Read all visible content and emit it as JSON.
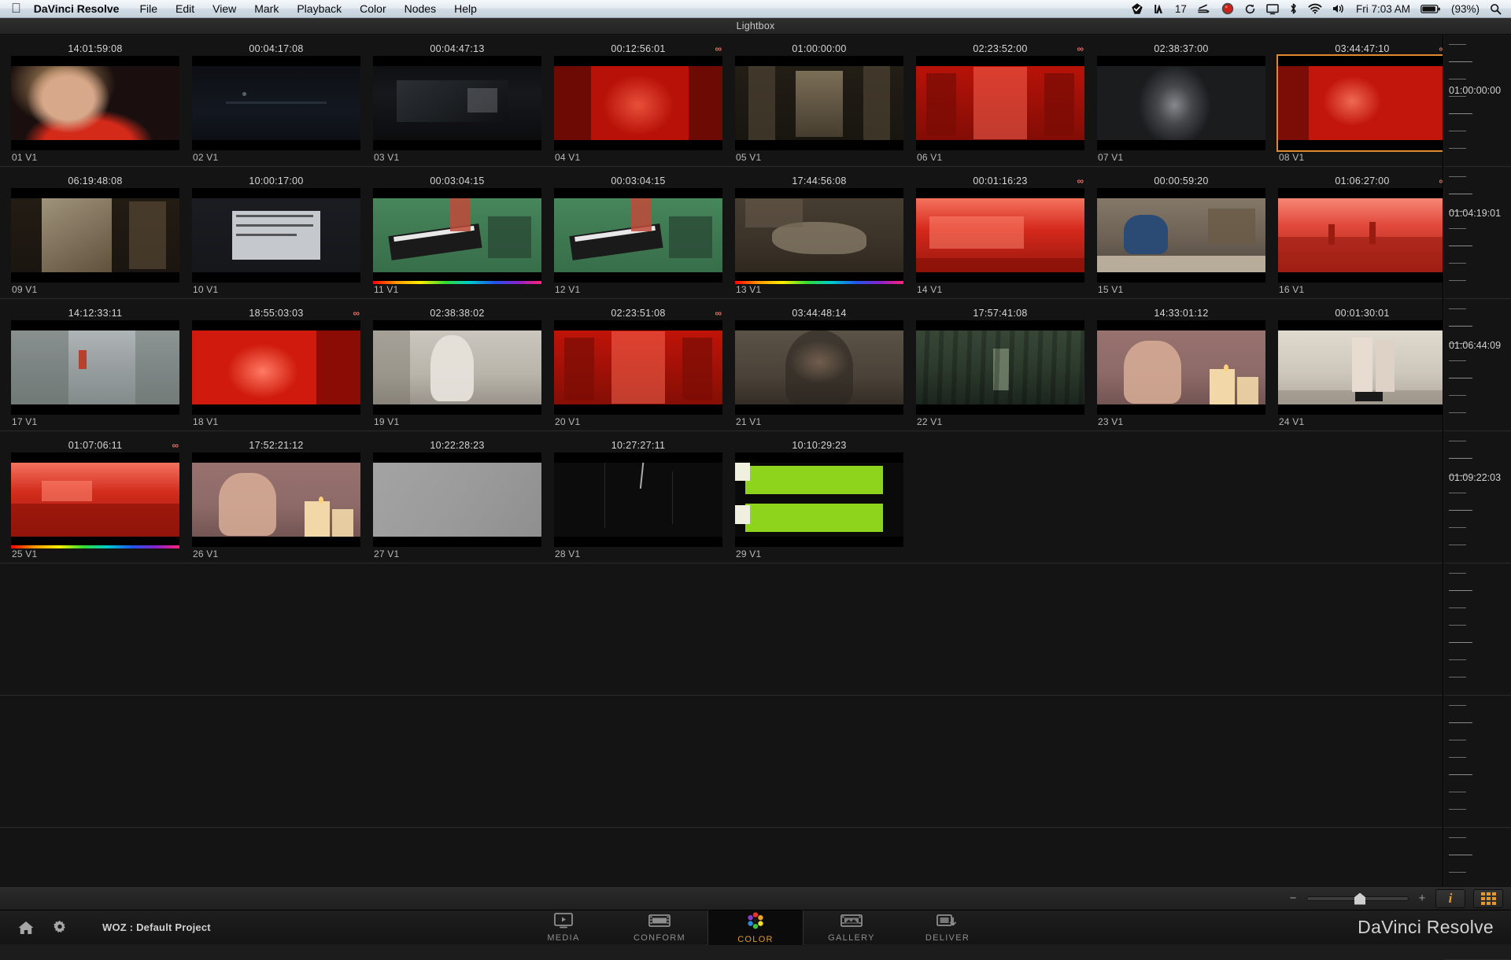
{
  "menubar": {
    "apple_icon": "apple-logo-icon",
    "items": [
      {
        "label": "DaVinci Resolve",
        "bold": true
      },
      {
        "label": "File"
      },
      {
        "label": "Edit"
      },
      {
        "label": "View"
      },
      {
        "label": "Mark"
      },
      {
        "label": "Playback"
      },
      {
        "label": "Color"
      },
      {
        "label": "Nodes"
      },
      {
        "label": "Help"
      }
    ],
    "status": {
      "dropbox_icon": "dropbox-check-icon",
      "alfred_icon": "alfred-hat-icon",
      "alfred_count": "17",
      "scanner_icon": "scanner-icon",
      "record_icon": "record-red-icon",
      "refresh_icon": "refresh-icon",
      "display_icon": "display-icon",
      "bluetooth_icon": "bluetooth-icon",
      "wifi_icon": "wifi-icon",
      "volume_icon": "volume-icon",
      "clock": "Fri 7:03 AM",
      "battery_icon": "battery-icon",
      "battery_pct": "(93%)",
      "spotlight_icon": "search-icon"
    }
  },
  "titlestrip": {
    "title": "Lightbox"
  },
  "lightbox": {
    "rows": [
      {
        "ruler_tc": "01:00:00:00",
        "clips": [
          {
            "tc": "14:01:59:08",
            "name": "01 V1",
            "linked": false,
            "selected": false,
            "rainbow": false,
            "img": {
              "kind": "portrait-red",
              "base": "#1a0f0e",
              "skin": "#d8a88a",
              "accent": "#d42a1a",
              "hair": "#caa06a"
            }
          },
          {
            "tc": "00:04:17:08",
            "name": "02 V1",
            "linked": false,
            "selected": false,
            "rainbow": false,
            "img": {
              "kind": "night-city",
              "base": "#0b0d10",
              "accent": "#3a4450",
              "glow": "#6a7684"
            }
          },
          {
            "tc": "00:04:47:13",
            "name": "03 V1",
            "linked": false,
            "selected": false,
            "rainbow": false,
            "img": {
              "kind": "night-window",
              "base": "#0a0b0d",
              "accent": "#2e3338",
              "glow": "#8e9298"
            }
          },
          {
            "tc": "00:12:56:01",
            "name": "04 V1",
            "linked": true,
            "selected": false,
            "rainbow": false,
            "img": {
              "kind": "red-portrait",
              "base": "#b81208",
              "skin": "#e8503a",
              "accent": "#6e0a04"
            }
          },
          {
            "tc": "01:00:00:00",
            "name": "05 V1",
            "linked": false,
            "selected": false,
            "rainbow": false,
            "img": {
              "kind": "corridor",
              "base": "#17140f",
              "accent": "#554a39",
              "glow": "#9a8a6e"
            }
          },
          {
            "tc": "02:23:52:00",
            "name": "06 V1",
            "linked": true,
            "selected": false,
            "rainbow": false,
            "img": {
              "kind": "red-interior",
              "base": "#c01309",
              "accent": "#7a0c05",
              "glow": "#ff6a55"
            }
          },
          {
            "tc": "02:38:37:00",
            "name": "07 V1",
            "linked": false,
            "selected": false,
            "rainbow": false,
            "img": {
              "kind": "statue-dark",
              "base": "#1b1c1e",
              "accent": "#45474b",
              "glow": "#86888d"
            }
          },
          {
            "tc": "03:44:47:10",
            "name": "08 V1",
            "linked": true,
            "selected": true,
            "rainbow": false,
            "img": {
              "kind": "red-woman",
              "base": "#c2150b",
              "skin": "#ef6a52",
              "accent": "#7c0d06"
            }
          }
        ]
      },
      {
        "ruler_tc": "01:04:19:01",
        "clips": [
          {
            "tc": "06:19:48:08",
            "name": "09 V1",
            "linked": false,
            "selected": false,
            "rainbow": false,
            "img": {
              "kind": "room-door",
              "base": "#19140f",
              "accent": "#6b5a42",
              "glow": "#b7a98e"
            }
          },
          {
            "tc": "10:00:17:00",
            "name": "10 V1",
            "linked": false,
            "selected": false,
            "rainbow": false,
            "img": {
              "kind": "slate-hand",
              "base": "#15161a",
              "accent": "#9aa0a8",
              "glow": "#d8dce0"
            }
          },
          {
            "tc": "00:03:04:15",
            "name": "11 V1",
            "linked": false,
            "selected": false,
            "rainbow": true,
            "img": {
              "kind": "greenscreen-slate",
              "base": "#3f7a52",
              "accent": "#1f3a2a",
              "glow": "#86b894"
            }
          },
          {
            "tc": "00:03:04:15",
            "name": "12 V1",
            "linked": false,
            "selected": false,
            "rainbow": false,
            "img": {
              "kind": "greenscreen-slate",
              "base": "#3f7a52",
              "accent": "#1f3a2a",
              "glow": "#86b894"
            }
          },
          {
            "tc": "17:44:56:08",
            "name": "13 V1",
            "linked": false,
            "selected": false,
            "rainbow": true,
            "img": {
              "kind": "ground-body",
              "base": "#3a3228",
              "accent": "#6b6050",
              "glow": "#a79a84"
            }
          },
          {
            "tc": "00:01:16:23",
            "name": "14 V1",
            "linked": true,
            "selected": false,
            "rainbow": false,
            "img": {
              "kind": "red-street",
              "base": "#d5291c",
              "accent": "#8b1208",
              "glow": "#ff8a72"
            }
          },
          {
            "tc": "00:00:59:20",
            "name": "15 V1",
            "linked": false,
            "selected": false,
            "rainbow": false,
            "img": {
              "kind": "garage-scene",
              "base": "#6e6256",
              "accent": "#2b4a74",
              "glow": "#c9bda9"
            }
          },
          {
            "tc": "01:06:27:00",
            "name": "16 V1",
            "linked": true,
            "selected": false,
            "rainbow": false,
            "img": {
              "kind": "red-desert",
              "base": "#e0483a",
              "accent": "#9a1b10",
              "glow": "#ff9d8a"
            }
          }
        ]
      },
      {
        "ruler_tc": "01:06:44:09",
        "clips": [
          {
            "tc": "14:12:33:11",
            "name": "17 V1",
            "linked": false,
            "selected": false,
            "rainbow": false,
            "img": {
              "kind": "beach-path",
              "base": "#9aa0a2",
              "accent": "#5a6360",
              "glow": "#d2d6d4"
            }
          },
          {
            "tc": "18:55:03:03",
            "name": "18 V1",
            "linked": true,
            "selected": false,
            "rainbow": false,
            "img": {
              "kind": "red-figure",
              "base": "#cf1a0d",
              "accent": "#7e0b04",
              "glow": "#ff7a62"
            }
          },
          {
            "tc": "02:38:38:02",
            "name": "19 V1",
            "linked": false,
            "selected": false,
            "rainbow": false,
            "img": {
              "kind": "statue-bright",
              "base": "#b9b4aa",
              "accent": "#6f6a60",
              "glow": "#e6e2da"
            }
          },
          {
            "tc": "02:23:51:08",
            "name": "20 V1",
            "linked": true,
            "selected": false,
            "rainbow": false,
            "img": {
              "kind": "red-interior",
              "base": "#c81409",
              "accent": "#7c0d05",
              "glow": "#ff6d56"
            }
          },
          {
            "tc": "03:44:48:14",
            "name": "21 V1",
            "linked": false,
            "selected": false,
            "rainbow": false,
            "img": {
              "kind": "hood-portrait",
              "base": "#4a4238",
              "skin": "#c8a588",
              "accent": "#2a251f"
            }
          },
          {
            "tc": "17:57:41:08",
            "name": "22 V1",
            "linked": false,
            "selected": false,
            "rainbow": false,
            "img": {
              "kind": "forest-figure",
              "base": "#2c3a2c",
              "accent": "#17201a",
              "glow": "#7e8e74"
            }
          },
          {
            "tc": "14:33:01:12",
            "name": "23 V1",
            "linked": false,
            "selected": false,
            "rainbow": false,
            "img": {
              "kind": "candle-woman",
              "base": "#8d6a68",
              "skin": "#d8ae96",
              "accent": "#f2d8a8"
            }
          },
          {
            "tc": "00:01:30:01",
            "name": "24 V1",
            "linked": false,
            "selected": false,
            "rainbow": false,
            "img": {
              "kind": "legs-stairs",
              "base": "#cfc8bc",
              "accent": "#8e867a",
              "glow": "#f2eee6"
            }
          }
        ]
      },
      {
        "ruler_tc": "01:09:22:03",
        "clips": [
          {
            "tc": "01:07:06:11",
            "name": "25 V1",
            "linked": true,
            "selected": false,
            "rainbow": true,
            "img": {
              "kind": "red-landscape",
              "base": "#d32c1c",
              "accent": "#8d1309",
              "glow": "#ff8b74"
            }
          },
          {
            "tc": "17:52:21:12",
            "name": "26 V1",
            "linked": false,
            "selected": false,
            "rainbow": false,
            "img": {
              "kind": "candle-woman",
              "base": "#8d6a68",
              "skin": "#d8ae96",
              "accent": "#f2d8a8"
            }
          },
          {
            "tc": "10:22:28:23",
            "name": "27 V1",
            "linked": false,
            "selected": false,
            "rainbow": false,
            "img": {
              "kind": "grey-flat",
              "base": "#9b9b9b",
              "accent": "#8a8a8a",
              "glow": "#b0b0b0"
            }
          },
          {
            "tc": "10:27:27:11",
            "name": "28 V1",
            "linked": false,
            "selected": false,
            "rainbow": false,
            "img": {
              "kind": "black-scratch",
              "base": "#0c0c0c",
              "accent": "#2a2a2a",
              "glow": "#c8c8c8"
            }
          },
          {
            "tc": "10:10:29:23",
            "name": "29 V1",
            "linked": false,
            "selected": false,
            "rainbow": false,
            "img": {
              "kind": "green-bars",
              "base": "#8fd41c",
              "accent": "#0a0a0a",
              "glow": "#f0f0e0"
            }
          }
        ]
      }
    ]
  },
  "zoombar": {
    "minus": "−",
    "plus": "+",
    "info_icon": "info-italic-icon",
    "grid_icon": "grid-view-icon"
  },
  "pagebar": {
    "home_icon": "home-icon",
    "gear_icon": "gear-icon",
    "project": "WOZ : Default Project",
    "pages": [
      {
        "label": "MEDIA",
        "icon": "media-monitor-icon",
        "active": false
      },
      {
        "label": "CONFORM",
        "icon": "conform-filmstrip-icon",
        "active": false
      },
      {
        "label": "COLOR",
        "icon": "color-wheel-icon",
        "active": true
      },
      {
        "label": "GALLERY",
        "icon": "gallery-stills-icon",
        "active": false
      },
      {
        "label": "DELIVER",
        "icon": "deliver-render-icon",
        "active": false
      }
    ],
    "brand": "DaVinci Resolve"
  },
  "colors": {
    "accent": "#e2992f",
    "selection": "#e08a2e",
    "link": "#ef6a5c",
    "bg": "#141414"
  }
}
